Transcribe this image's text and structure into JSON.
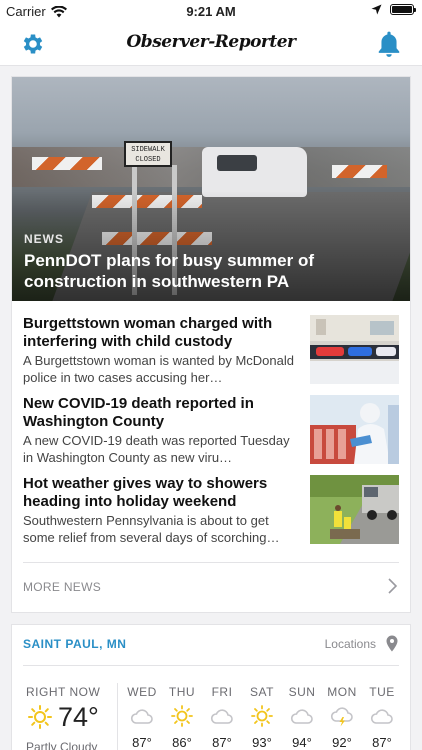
{
  "status_bar": {
    "carrier": "Carrier",
    "time": "9:21 AM"
  },
  "nav": {
    "brand": "Observer-Reporter"
  },
  "featured": {
    "kicker": "NEWS",
    "headline": "PennDOT plans for busy summer of construction in southwestern PA",
    "sign_text": "SIDEWALK CLOSED"
  },
  "stories": [
    {
      "title": "Burgettstown woman charged with interfering with child custody",
      "summary": "A Burgettstown woman is wanted by McDonald police in two cases accusing her…",
      "thumb": "police-lights"
    },
    {
      "title": "New COVID-19 death reported in Washington County",
      "summary": "A new COVID-19 death was reported Tuesday in Washington County as new viru…",
      "thumb": "lab-worker"
    },
    {
      "title": "Hot weather gives way to showers heading into holiday weekend",
      "summary": "Southwestern Pennsylvania is about to get some relief from several days of scorching…",
      "thumb": "road-crew"
    }
  ],
  "more_news": "MORE NEWS",
  "weather": {
    "city": "SAINT PAUL, MN",
    "locations_label": "Locations",
    "now": {
      "label": "RIGHT NOW",
      "temp": "74°",
      "condition": "Partly Cloudy",
      "icon": "sun-icon"
    },
    "forecast": [
      {
        "day": "WED",
        "hi": "87°",
        "icon": "cloud-icon"
      },
      {
        "day": "THU",
        "hi": "86°",
        "icon": "sun-icon"
      },
      {
        "day": "FRI",
        "hi": "87°",
        "icon": "cloud-icon"
      },
      {
        "day": "SAT",
        "hi": "93°",
        "icon": "sun-icon"
      },
      {
        "day": "SUN",
        "hi": "94°",
        "icon": "cloud-icon"
      },
      {
        "day": "MON",
        "hi": "92°",
        "icon": "thunderstorm-icon"
      },
      {
        "day": "TUE",
        "hi": "87°",
        "icon": "cloud-icon"
      }
    ]
  },
  "colors": {
    "accent": "#2a8fc6",
    "sun": "#f2c51d",
    "cloud": "#c4c4c8"
  }
}
